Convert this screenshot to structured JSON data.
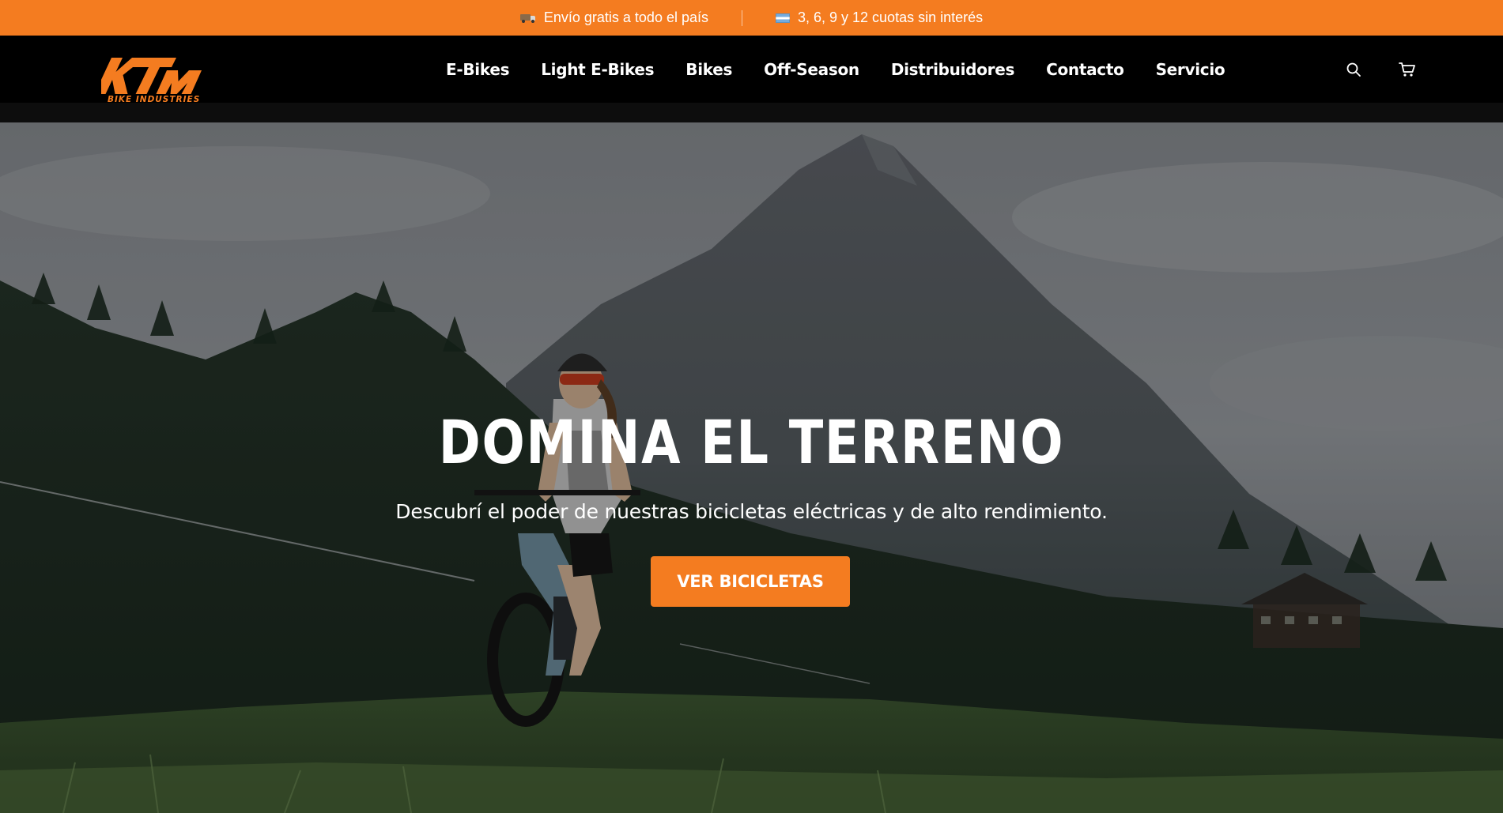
{
  "announcement": {
    "shipping_icon": "truck-icon",
    "shipping_text": "Envío gratis a todo el país",
    "installments_icon": "argentina-flag-icon",
    "installments_text": "3, 6, 9 y 12 cuotas sin interés"
  },
  "brand": {
    "name": "KTM",
    "tagline": "BIKE INDUSTRIES",
    "accent_color": "#f47c20"
  },
  "nav": {
    "items": [
      {
        "label": "E-Bikes"
      },
      {
        "label": "Light E-Bikes"
      },
      {
        "label": "Bikes"
      },
      {
        "label": "Off-Season"
      },
      {
        "label": "Distribuidores"
      },
      {
        "label": "Contacto"
      },
      {
        "label": "Servicio"
      }
    ]
  },
  "header_icons": {
    "search": "search-icon",
    "cart": "cart-icon"
  },
  "hero": {
    "title": "DOMINA EL TERRENO",
    "subtitle": "Descubrí el poder de nuestras bicicletas eléctricas y de alto rendimiento.",
    "cta_label": "VER BICICLETAS"
  }
}
